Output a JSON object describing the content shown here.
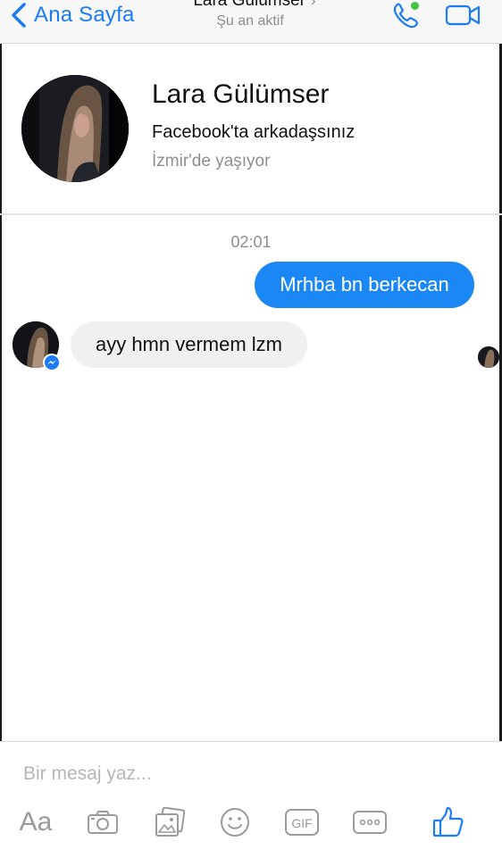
{
  "nav": {
    "back_label": "Ana Sayfa",
    "title": "Lara Gülümser",
    "status": "Şu an aktif"
  },
  "profile": {
    "name": "Lara Gülümser",
    "friendship": "Facebook'ta arkadaşsınız",
    "location": "İzmir'de yaşıyor"
  },
  "conversation": {
    "timestamp": "02:01",
    "messages": [
      {
        "direction": "outgoing",
        "text": "Mrhba bn berkecan"
      },
      {
        "direction": "incoming",
        "text": "ayy hmn vermem lzm"
      }
    ]
  },
  "composer": {
    "placeholder": "Bir mesaj yaz...",
    "aa_label": "Aa",
    "tools": [
      "text-size-icon",
      "camera-icon",
      "gallery-icon",
      "emoji-icon",
      "gif-icon",
      "more-icon",
      "like-icon"
    ]
  },
  "colors": {
    "accent": "#1b7cf6",
    "bubble_outgoing": "#1b87f5",
    "bubble_incoming": "#f0f0f0",
    "online": "#44c53e",
    "muted_text": "#8e8e93"
  }
}
